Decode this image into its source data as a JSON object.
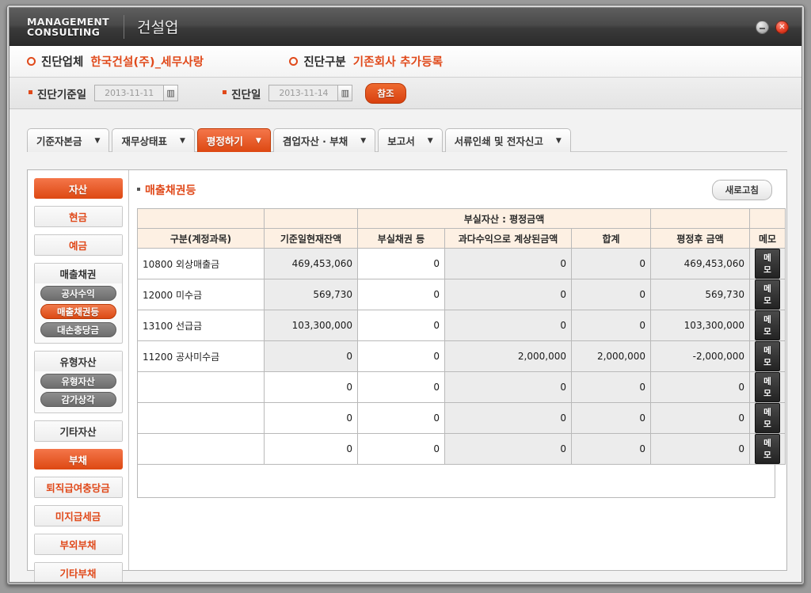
{
  "window": {
    "logo_line1": "MANAGEMENT",
    "logo_line2": "CONSULTING",
    "logo_korean": "건설업",
    "minimize_label": "−",
    "close_label": "✕"
  },
  "info_bar": {
    "company_label": "진단업체",
    "company_value": "한국건설(주)_세무사랑",
    "type_label": "진단구분",
    "type_value": "기존회사  추가등록"
  },
  "date_bar": {
    "base_date_label": "진단기준일",
    "base_date_value": "2013-11-11",
    "diag_date_label": "진단일",
    "diag_date_value": "2013-11-14",
    "calendar_icon": "calendar-icon",
    "reference_button": "참조"
  },
  "tabs": [
    {
      "label": "기준자본금",
      "caret": "▼",
      "active": false
    },
    {
      "label": "재무상태표",
      "caret": "▼",
      "active": false
    },
    {
      "label": "평정하기",
      "caret": "▼",
      "active": true
    },
    {
      "label": "겸업자산 · 부채",
      "caret": "▼",
      "active": false
    },
    {
      "label": "보고서",
      "caret": "▼",
      "active": false
    },
    {
      "label": "서류인쇄 및 전자신고",
      "caret": "▼",
      "active": false
    }
  ],
  "sidebar": {
    "groups": [
      {
        "head": "자산",
        "style": "primary",
        "pills": []
      },
      {
        "head": "현금",
        "style": "orange",
        "pills": []
      },
      {
        "head": "예금",
        "style": "orange",
        "pills": []
      },
      {
        "head": "매출채권",
        "style": "dark",
        "pills": [
          {
            "label": "공사수익",
            "selected": false
          },
          {
            "label": "매출채권등",
            "selected": true
          },
          {
            "label": "대손충당금",
            "selected": false
          }
        ]
      },
      {
        "head": "유형자산",
        "style": "dark",
        "pills": [
          {
            "label": "유형자산",
            "selected": false
          },
          {
            "label": "감가상각",
            "selected": false
          }
        ]
      },
      {
        "head": "기타자산",
        "style": "dark",
        "pills": []
      },
      {
        "head": "부채",
        "style": "primary",
        "pills": []
      },
      {
        "head": "퇴직급여충당금",
        "style": "orange",
        "pills": []
      },
      {
        "head": "미지급세금",
        "style": "orange",
        "pills": []
      },
      {
        "head": "부외부채",
        "style": "orange",
        "pills": []
      },
      {
        "head": "기타부채",
        "style": "orange",
        "pills": []
      }
    ]
  },
  "main": {
    "section_title": "매출채권등",
    "refresh_button": "새로고침",
    "table": {
      "group_header": "부실자산 : 평정금액",
      "columns": [
        "구분(계정과목)",
        "기준일현재잔액",
        "부실채권 등",
        "과다수익으로 계상된금액",
        "합계",
        "평정후 금액",
        "메모"
      ],
      "memo_button_label": "메모",
      "rows": [
        {
          "account": "10800 외상매출금",
          "base_balance": "469,453,060",
          "bad_debt": "0",
          "excess_revenue": "0",
          "total": "0",
          "after_assessment": "469,453,060",
          "memo": "메모"
        },
        {
          "account": "12000 미수금",
          "base_balance": "569,730",
          "bad_debt": "0",
          "excess_revenue": "0",
          "total": "0",
          "after_assessment": "569,730",
          "memo": "메모"
        },
        {
          "account": "13100 선급금",
          "base_balance": "103,300,000",
          "bad_debt": "0",
          "excess_revenue": "0",
          "total": "0",
          "after_assessment": "103,300,000",
          "memo": "메모"
        },
        {
          "account": "11200 공사미수금",
          "base_balance": "0",
          "bad_debt": "0",
          "excess_revenue": "2,000,000",
          "total": "2,000,000",
          "after_assessment": "-2,000,000",
          "memo": "메모"
        },
        {
          "account": "",
          "base_balance": "0",
          "bad_debt": "0",
          "excess_revenue": "0",
          "total": "0",
          "after_assessment": "0",
          "memo": "메모"
        },
        {
          "account": "",
          "base_balance": "0",
          "bad_debt": "0",
          "excess_revenue": "0",
          "total": "0",
          "after_assessment": "0",
          "memo": "메모"
        },
        {
          "account": "",
          "base_balance": "0",
          "bad_debt": "0",
          "excess_revenue": "0",
          "total": "0",
          "after_assessment": "0",
          "memo": "메모"
        }
      ]
    }
  },
  "colors": {
    "accent_orange": "#e0491a",
    "tab_active_start": "#f4764a",
    "tab_active_end": "#dd4812",
    "table_header_bg": "#fdf0e3",
    "readonly_cell_bg": "#ececec"
  }
}
